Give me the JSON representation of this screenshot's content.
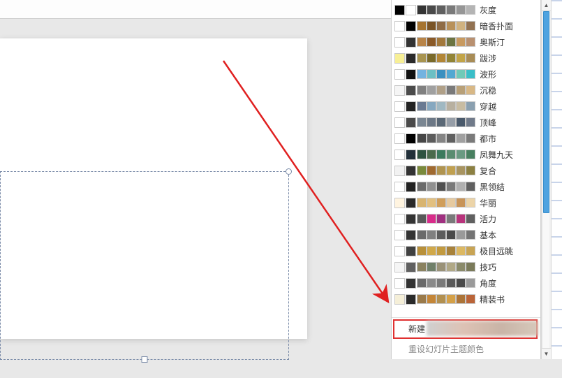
{
  "themes": [
    {
      "name": "灰度",
      "colors": [
        "#000000",
        "#ffffff",
        "#343434",
        "#4a4a4a",
        "#606060",
        "#7a7a7a",
        "#969696",
        "#b4b4b4"
      ]
    },
    {
      "name": "暗香扑面",
      "colors": [
        "#ffffff",
        "#000000",
        "#a67430",
        "#7a5426",
        "#8f6c46",
        "#b8915a",
        "#d0b280",
        "#927252"
      ]
    },
    {
      "name": "奥斯汀",
      "colors": [
        "#ffffff",
        "#333333",
        "#b88448",
        "#8a5a28",
        "#a2783c",
        "#6c7442",
        "#c89a60",
        "#b89070"
      ]
    },
    {
      "name": "跋涉",
      "colors": [
        "#f7ef96",
        "#2a2a2a",
        "#a89450",
        "#7a6a2a",
        "#b28636",
        "#928436",
        "#c2a448",
        "#a88c56"
      ]
    },
    {
      "name": "波形",
      "colors": [
        "#ffffff",
        "#111111",
        "#73b3e0",
        "#6cc0c4",
        "#3a90c0",
        "#52a8d2",
        "#6fcab8",
        "#3abec8"
      ]
    },
    {
      "name": "沉稳",
      "colors": [
        "#f5f5f5",
        "#4a4a4a",
        "#808080",
        "#a0a0a0",
        "#b0a088",
        "#7a7a7a",
        "#b8a078",
        "#d8b886"
      ]
    },
    {
      "name": "穿越",
      "colors": [
        "#ffffff",
        "#222222",
        "#6a7a92",
        "#86a8c0",
        "#a0b8c2",
        "#b8b0a0",
        "#c8bca2",
        "#8aa0b0"
      ]
    },
    {
      "name": "顶峰",
      "colors": [
        "#ffffff",
        "#4a4a4a",
        "#7a8692",
        "#6c7886",
        "#5a6876",
        "#969ea8",
        "#4a5a6c",
        "#707a8a"
      ]
    },
    {
      "name": "都市",
      "colors": [
        "#ffffff",
        "#000000",
        "#464646",
        "#5c5c5c",
        "#848484",
        "#606060",
        "#a0a0a0",
        "#7a7a7a"
      ]
    },
    {
      "name": "凤舞九天",
      "colors": [
        "#ffffff",
        "#22303a",
        "#2e5240",
        "#4a6a4c",
        "#3c7a5e",
        "#5a8c70",
        "#6a9a82",
        "#488060"
      ]
    },
    {
      "name": "复合",
      "colors": [
        "#f2f2f2",
        "#333333",
        "#7a8a3c",
        "#a06a30",
        "#b09450",
        "#c0a050",
        "#a89460",
        "#8c8042"
      ]
    },
    {
      "name": "黑领结",
      "colors": [
        "#ffffff",
        "#222222",
        "#6a6a6a",
        "#909090",
        "#505050",
        "#7a7a7a",
        "#b0b0b0",
        "#606060"
      ]
    },
    {
      "name": "华丽",
      "colors": [
        "#fff4e0",
        "#2a2a2a",
        "#d8b470",
        "#e2c080",
        "#d09e5a",
        "#e6caa0",
        "#c89458",
        "#ecd4a8"
      ]
    },
    {
      "name": "活力",
      "colors": [
        "#ffffff",
        "#333333",
        "#585858",
        "#d82c8a",
        "#a03080",
        "#7a7a7a",
        "#b8347c",
        "#606060"
      ]
    },
    {
      "name": "基本",
      "colors": [
        "#ffffff",
        "#333333",
        "#6a6a6a",
        "#808080",
        "#5c5c5c",
        "#4a4a4a",
        "#9a9a9a",
        "#747474"
      ]
    },
    {
      "name": "极目远眺",
      "colors": [
        "#ffffff",
        "#404040",
        "#b8903a",
        "#d0a84a",
        "#c29a40",
        "#a8823a",
        "#dcb862",
        "#c8a454"
      ]
    },
    {
      "name": "技巧",
      "colors": [
        "#f5f5f5",
        "#606060",
        "#8a8260",
        "#70806a",
        "#9a9278",
        "#b0a886",
        "#8a8a6a",
        "#7a7a5a"
      ]
    },
    {
      "name": "角度",
      "colors": [
        "#ffffff",
        "#333333",
        "#6a6a6a",
        "#8a8a8a",
        "#7a7a7a",
        "#5a5a5a",
        "#4a4a4a",
        "#9a9a9a"
      ]
    },
    {
      "name": "精装书",
      "colors": [
        "#f5efd8",
        "#2a2a2a",
        "#9a7a4a",
        "#c48638",
        "#b29050",
        "#d4a048",
        "#ac7438",
        "#ba6438"
      ]
    }
  ],
  "footer": {
    "new_label": "新建",
    "reset_label": "重设幻灯片主题颜色"
  }
}
